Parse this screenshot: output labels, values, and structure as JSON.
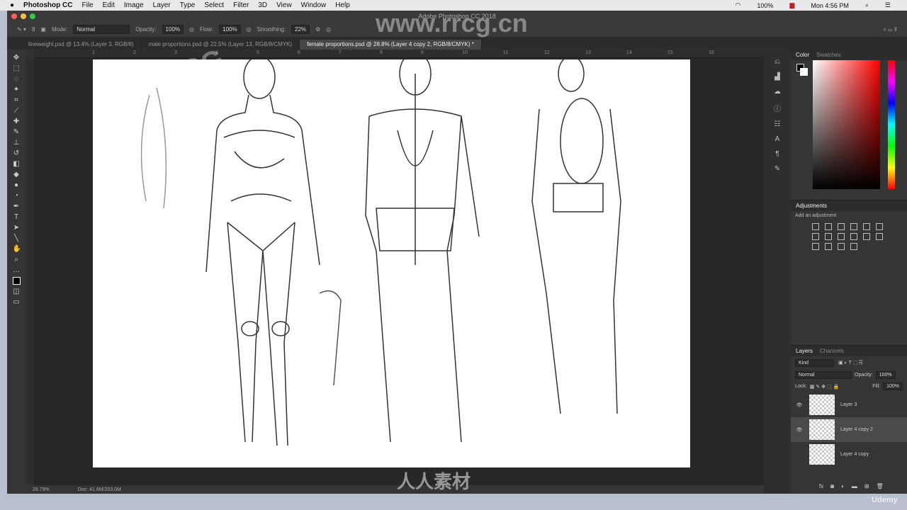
{
  "menubar": {
    "app": "Photoshop CC",
    "items": [
      "File",
      "Edit",
      "Image",
      "Layer",
      "Type",
      "Select",
      "Filter",
      "3D",
      "View",
      "Window",
      "Help"
    ],
    "battery": "100%",
    "clock": "Mon 4:56 PM"
  },
  "window": {
    "title": "Adobe Photoshop CC 2018"
  },
  "options": {
    "mode_label": "Mode:",
    "mode": "Normal",
    "opacity_label": "Opacity:",
    "opacity": "100%",
    "flow_label": "Flow:",
    "flow": "100%",
    "smoothing_label": "Smoothing:",
    "smoothing": "22%",
    "brush_size": "8"
  },
  "tabs": [
    {
      "label": "lineweight.psd @ 13.4% (Layer 3, RGB/8)"
    },
    {
      "label": "male proportions.psd @ 22.5% (Layer 13, RGB/8/CMYK)"
    },
    {
      "label": "female proportions.psd @ 28.8% (Layer 4 copy 2, RGB/8/CMYK) *"
    }
  ],
  "ruler": [
    "1",
    "2",
    "3",
    "4",
    "5",
    "6",
    "7",
    "8",
    "9",
    "10",
    "11",
    "12",
    "13",
    "14",
    "15",
    "16"
  ],
  "status": {
    "zoom": "28.79%",
    "doc": "Doc: 41.6M/203.0M"
  },
  "color_panel": {
    "tabs": [
      "Color",
      "Swatches"
    ]
  },
  "adjustments": {
    "title": "Adjustments",
    "subtitle": "Add an adjustment"
  },
  "layers_panel": {
    "tabs": [
      "Layers",
      "Channels"
    ],
    "filter": "Kind",
    "blend": "Normal",
    "opacity_label": "Opacity:",
    "opacity": "100%",
    "lock_label": "Lock:",
    "fill_label": "Fill:",
    "fill": "100%",
    "layers": [
      {
        "name": "Layer 3",
        "visible": true,
        "selected": false
      },
      {
        "name": "Layer 4 copy 2",
        "visible": true,
        "selected": true
      },
      {
        "name": "Layer 4 copy",
        "visible": false,
        "selected": false
      }
    ]
  },
  "watermarks": {
    "site": "www.rrcg.cn",
    "brand": "RRCG",
    "cn": "人人素材",
    "udemy": "Udemy"
  }
}
